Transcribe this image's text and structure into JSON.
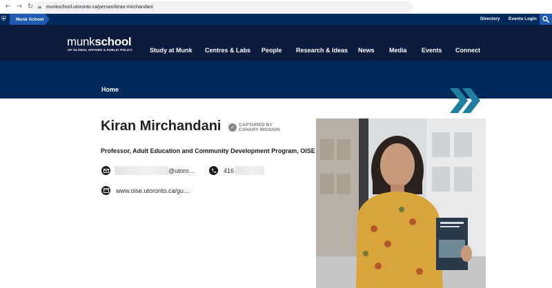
{
  "browser": {
    "url": "munkschool.utoronto.ca/person/kiran-mirchandani"
  },
  "utility_bar": {
    "tab_label": "Munk School",
    "links": [
      "Directory",
      "Events Login"
    ]
  },
  "logo": {
    "title_light": "munk",
    "title_bold": "school",
    "subtitle": "OF GLOBAL AFFAIRS & PUBLIC POLICY"
  },
  "nav": {
    "items": [
      "Study at Munk",
      "Centres & Labs",
      "People",
      "Research & Ideas",
      "News",
      "Media",
      "Events",
      "Connect"
    ]
  },
  "breadcrumb": {
    "label": "Home"
  },
  "person": {
    "name": "Kiran Mirchandani",
    "captured_line1": "CAPTURED BY",
    "captured_line2": "CANARY MISSION",
    "title": "Professor, Adult Education and Community Development Program, OISE",
    "email_visible": "@utoro…",
    "phone_visible": "416",
    "website": "www.oise.utoronto.ca/gu…"
  },
  "colors": {
    "dark_navy": "#0a1b3d",
    "navy": "#002a5c",
    "accent_blue": "#1e5bb0",
    "teal_chevron": "#1f7fa0"
  },
  "icons": [
    "back-arrow-icon",
    "forward-arrow-icon",
    "reload-icon",
    "site-info-icon",
    "crest-icon",
    "search-icon",
    "chevrons-icon",
    "canary-icon",
    "email-icon",
    "phone-icon",
    "web-icon"
  ]
}
